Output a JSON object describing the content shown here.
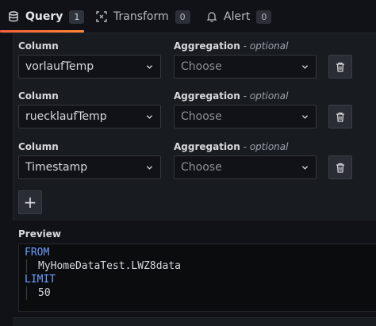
{
  "tabs": [
    {
      "label": "Query",
      "count": "1",
      "icon": "database-icon"
    },
    {
      "label": "Transform",
      "count": "0",
      "icon": "transform-icon"
    },
    {
      "label": "Alert",
      "count": "0",
      "icon": "bell-icon"
    }
  ],
  "rows": [
    {
      "column_label": "Column",
      "aggregation_label": "Aggregation",
      "optional": " - optional",
      "column_value": "vorlaufTemp",
      "aggregation_value": "Choose"
    },
    {
      "column_label": "Column",
      "aggregation_label": "Aggregation",
      "optional": " - optional",
      "column_value": "ruecklaufTemp",
      "aggregation_value": "Choose"
    },
    {
      "column_label": "Column",
      "aggregation_label": "Aggregation",
      "optional": " - optional",
      "column_value": "Timestamp",
      "aggregation_value": "Choose"
    }
  ],
  "add_label": "+",
  "preview": {
    "label": "Preview",
    "lines": [
      {
        "keyword": "FROM",
        "value": "MyHomeDataTest.LWZ8data"
      },
      {
        "keyword": "LIMIT",
        "value": "50"
      }
    ]
  },
  "colors": {
    "accent": "#f55f3e",
    "keyword": "#6e9fff",
    "background": "#111217"
  }
}
